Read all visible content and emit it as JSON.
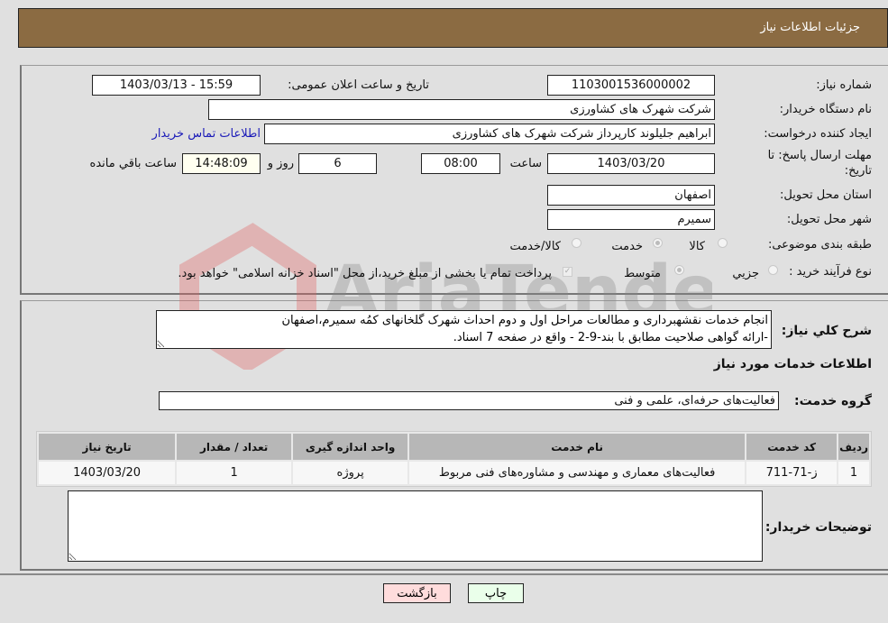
{
  "header": {
    "title": "جزئیات اطلاعات نیاز"
  },
  "need_info": {
    "need_number_label": "شماره نیاز:",
    "need_number": "1103001536000002",
    "announce_datetime_label": "تاریخ و ساعت اعلان عمومی:",
    "announce_datetime": "1403/03/13 - 15:59",
    "buyer_org_label": "نام دستگاه خریدار:",
    "buyer_org": "شرکت شهرک های کشاورزی",
    "requester_label": "ایجاد کننده درخواست:",
    "requester": "ابراهیم جلیلوند کارپرداز شرکت شهرک های کشاورزی",
    "buyer_contact_link": "اطلاعات تماس خریدار",
    "deadline_label": "مهلت ارسال پاسخ: تا تاریخ:",
    "deadline_date": "1403/03/20",
    "time_label": "ساعت",
    "deadline_time": "08:00",
    "days_remaining": "6",
    "days_and_label": "روز و",
    "time_remaining": "14:48:09",
    "time_remaining_label": "ساعت باقي مانده",
    "province_label": "استان محل تحویل:",
    "province": "اصفهان",
    "city_label": "شهر محل تحویل:",
    "city": "سمیرم",
    "category_label": "طبقه بندی موضوعی:",
    "category_options": [
      "کالا",
      "خدمت",
      "کالا/خدمت"
    ],
    "category_selected": "خدمت",
    "purchase_type_label": "نوع فرآیند خرید :",
    "purchase_type_options": [
      "جزيي",
      "متوسط"
    ],
    "purchase_type_selected": "متوسط",
    "treasury_note": "پرداخت تمام یا بخشی از مبلغ خرید،از محل \"اسناد خزانه اسلامی\" خواهد بود."
  },
  "description": {
    "label": "شرح كلي نياز:",
    "text": "انجام خدمات نقشهبرداری و مطالعات مراحل اول و دوم احداث شهرک گلخانهای کمُه سمیرم،اصفهان\n-ارائه گواهی صلاحیت مطابق با بند-9-2 - واقع در صفحه 7 اسناد."
  },
  "services": {
    "section_title": "اطلاعات خدمات مورد نیاز",
    "group_label": "گروه خدمت:",
    "group_value": "فعالیت‌های حرفه‌ای، علمی و فنی",
    "table": {
      "headers": [
        "ردیف",
        "کد خدمت",
        "نام خدمت",
        "واحد اندازه گیری",
        "تعداد / مقدار",
        "تاریخ نیاز"
      ],
      "rows": [
        [
          "1",
          "ز-71-711",
          "فعالیت‌های معماری و مهندسی و مشاوره‌های فنی مربوط",
          "پروژه",
          "1",
          "1403/03/20"
        ]
      ]
    }
  },
  "buyer_notes": {
    "label": "توضیحات خریدار:",
    "value": ""
  },
  "buttons": {
    "print": "چاپ",
    "back": "بازگشت"
  },
  "watermark": {
    "text": "AriaTender.neT"
  },
  "colors": {
    "header_bg": "#8b6b42",
    "print_bg": "#eaffea",
    "back_bg": "#ffdcdc",
    "link": "#1a1ab8"
  }
}
